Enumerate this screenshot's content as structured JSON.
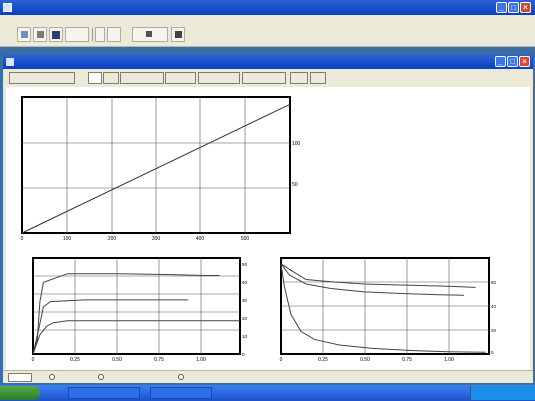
{
  "app": {
    "title": "",
    "menu": [
      "",
      "",
      "",
      "",
      "",
      "",
      ""
    ]
  },
  "toolbar": {
    "items": [
      {
        "icon": "tool-icon",
        "label": ""
      },
      {
        "icon": "tool-icon",
        "label": ""
      },
      {
        "icon": "save-icon",
        "label": ""
      },
      {
        "icon": "",
        "label": ""
      },
      {
        "icon": "",
        "label": ""
      },
      {
        "icon": "",
        "label": ""
      },
      {
        "icon": "tool-icon",
        "label": ""
      },
      {
        "icon": "tool-icon",
        "label": ""
      }
    ]
  },
  "window": {
    "title": "",
    "tabs": [
      "",
      "",
      "",
      "",
      "",
      "",
      "",
      "",
      ""
    ],
    "active_tab_index": 1
  },
  "chart_data": [
    {
      "type": "line",
      "title": "",
      "xticks": [
        "0",
        "100",
        "200",
        "300",
        "400",
        "500"
      ],
      "yticks": [
        "100",
        "50"
      ],
      "xlim": [
        0,
        560
      ],
      "ylim": [
        0,
        150
      ],
      "series": [
        {
          "name": "",
          "x": [
            0,
            560
          ],
          "y": [
            0,
            142
          ]
        }
      ]
    },
    {
      "type": "line",
      "title": "",
      "xticks": [
        "0",
        "0.25",
        "0.50",
        "0.75",
        "1.00"
      ],
      "yticks": [
        "0",
        "10",
        "20",
        "30",
        "40",
        "50"
      ],
      "xlim": [
        0,
        1.2
      ],
      "ylim": [
        0,
        55
      ],
      "series": [
        {
          "name": "",
          "x": [
            0,
            0.025,
            0.04,
            0.06,
            0.2,
            0.5,
            0.8,
            1.0,
            1.08
          ],
          "y": [
            0,
            8,
            30,
            41,
            46,
            46,
            45.5,
            45,
            45
          ]
        },
        {
          "name": "",
          "x": [
            0,
            0.035,
            0.06,
            0.1,
            0.3,
            0.6,
            0.8,
            0.9
          ],
          "y": [
            0,
            15,
            27,
            30,
            31,
            31,
            31,
            31
          ]
        },
        {
          "name": "",
          "x": [
            0,
            0.04,
            0.08,
            0.12,
            0.2,
            0.5,
            0.8,
            1.0,
            1.2
          ],
          "y": [
            0,
            11,
            16,
            18,
            19,
            19,
            19,
            19,
            19
          ]
        }
      ]
    },
    {
      "type": "line",
      "title": "",
      "xticks": [
        "0",
        "0.25",
        "0.50",
        "0.75",
        "1.00"
      ],
      "yticks": [
        "60",
        "40",
        "20",
        "0"
      ],
      "xlim": [
        0,
        1.25
      ],
      "ylim": [
        0,
        85
      ],
      "series": [
        {
          "name": "",
          "x": [
            0,
            0.05,
            0.15,
            0.3,
            0.5,
            0.75,
            1.0,
            1.17
          ],
          "y": [
            80,
            75,
            66,
            64,
            62,
            61,
            60,
            59
          ]
        },
        {
          "name": "",
          "x": [
            0,
            0.05,
            0.15,
            0.3,
            0.5,
            0.75,
            0.95,
            1.1
          ],
          "y": [
            80,
            70,
            62,
            58,
            55,
            53.5,
            52.5,
            52
          ]
        },
        {
          "name": "",
          "x": [
            0,
            0.02,
            0.06,
            0.12,
            0.2,
            0.35,
            0.55,
            0.8,
            1.0,
            1.23
          ],
          "y": [
            80,
            60,
            35,
            20,
            13,
            8,
            5,
            3,
            2,
            1.5
          ]
        }
      ]
    }
  ],
  "legend": [
    {
      "line1": "",
      "line2": "",
      "color": "#e8542b"
    },
    {
      "line1": "",
      "line2": "",
      "color": "#5a3fa8"
    }
  ],
  "status": {
    "items": [
      "",
      "",
      "",
      "",
      ""
    ]
  },
  "taskbar": {
    "start_label": "",
    "tasks": [
      "",
      ""
    ],
    "clock": ""
  },
  "colors": {
    "titlebar": "#0a3fbf",
    "frame": "#ece9d8",
    "desktop": "#3a6ea5",
    "legend_red": "#e8542b",
    "legend_purple": "#5a3fa8"
  }
}
